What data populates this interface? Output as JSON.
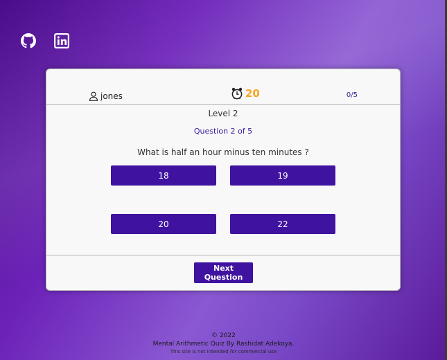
{
  "social": {
    "github_icon": "github-icon",
    "linkedin_icon": "linkedin-icon"
  },
  "header": {
    "username": "jones",
    "timer": "20",
    "score": "0/5"
  },
  "quiz": {
    "level": "Level 2",
    "question_number": "Question 2 of 5",
    "question": "What is half an hour minus ten minutes ?",
    "answers": [
      "18",
      "19",
      "20",
      "22"
    ],
    "next_label": "Next Question"
  },
  "footer": {
    "copyright": "© 2022",
    "credit": "Mental Arithmetic Quiz By Rashidat Adekoya.",
    "note": "This site is not intended for commercial use"
  },
  "colors": {
    "accent": "#3f12a0",
    "timer": "#f5a623",
    "score": "#3a1a8a"
  }
}
